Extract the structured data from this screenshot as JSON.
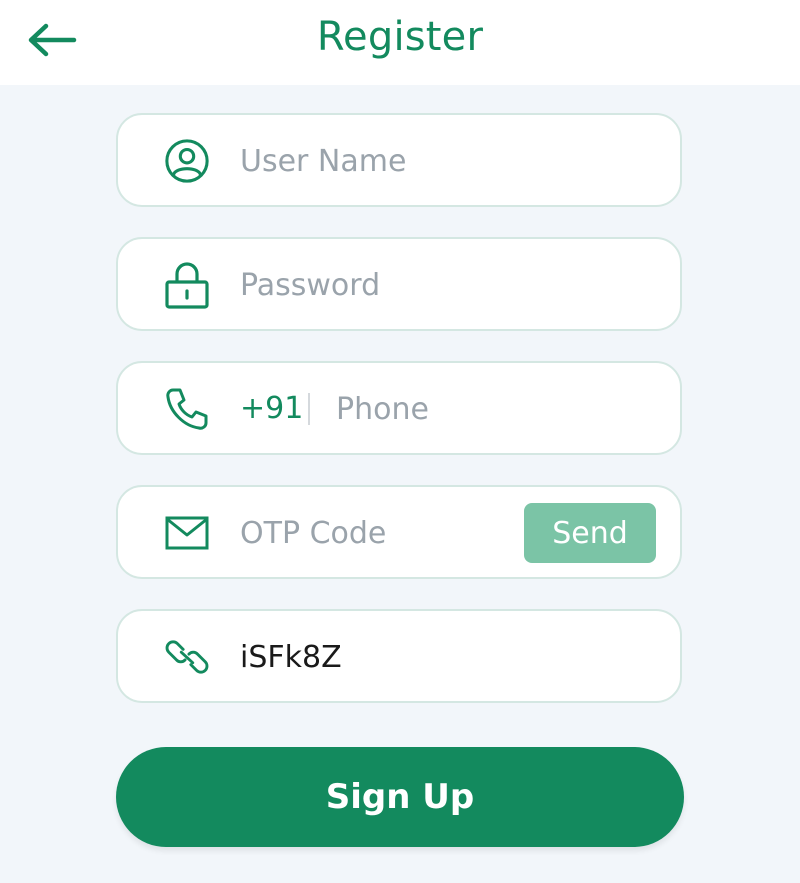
{
  "header": {
    "title": "Register",
    "back_icon": "arrow-left-icon"
  },
  "form": {
    "username": {
      "placeholder": "User Name",
      "value": "",
      "icon": "user-icon"
    },
    "password": {
      "placeholder": "Password",
      "value": "",
      "icon": "lock-icon"
    },
    "phone": {
      "prefix": "+91",
      "placeholder": "Phone",
      "value": "",
      "icon": "phone-icon"
    },
    "otp": {
      "placeholder": "OTP Code",
      "value": "",
      "send_label": "Send",
      "icon": "mail-icon"
    },
    "invite": {
      "value": "iSFk8Z",
      "icon": "link-icon"
    }
  },
  "signup_label": "Sign Up",
  "colors": {
    "accent": "#138a5e",
    "send_button": "#7bc4a6",
    "field_border": "#d4e7e2",
    "background": "#f2f6fa"
  }
}
